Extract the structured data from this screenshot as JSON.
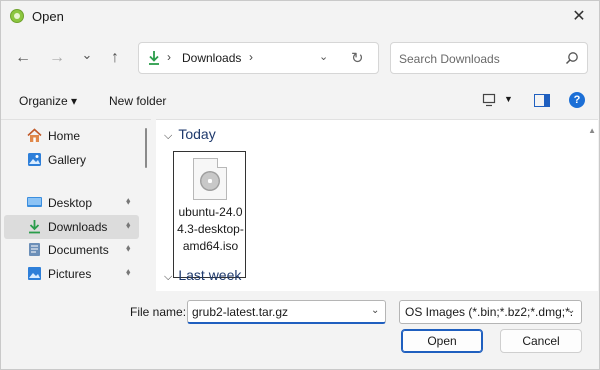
{
  "window": {
    "title": "Open",
    "close_glyph": "✕"
  },
  "nav": {
    "back_glyph": "←",
    "forward_glyph": "→",
    "recent_glyph": "⌄",
    "up_glyph": "↑",
    "address": {
      "icon": "download-arrow-icon",
      "path": "Downloads",
      "sep": "›",
      "drop_glyph": "⌄",
      "refresh_glyph": "↻"
    },
    "search": {
      "placeholder": "Search Downloads"
    }
  },
  "command_bar": {
    "organize_label": "Organize ▾",
    "new_folder_label": "New folder",
    "view_drop_glyph": "▼",
    "help_glyph": "?"
  },
  "sidebar": {
    "items": [
      {
        "label": "Home",
        "icon": "home-icon",
        "pinned": false
      },
      {
        "label": "Gallery",
        "icon": "gallery-icon",
        "pinned": false
      },
      {
        "label": "Desktop",
        "icon": "desktop-icon",
        "pinned": true
      },
      {
        "label": "Downloads",
        "icon": "download-arrow-icon",
        "pinned": true,
        "selected": true
      },
      {
        "label": "Documents",
        "icon": "documents-icon",
        "pinned": true
      },
      {
        "label": "Pictures",
        "icon": "pictures-icon",
        "pinned": true
      }
    ],
    "pin_glyph": "📌"
  },
  "main": {
    "groups": [
      {
        "label": "Today",
        "chevron": "⌵"
      },
      {
        "label": "Last week",
        "chevron": "⌵"
      }
    ],
    "files": [
      {
        "name": "ubuntu-24.04.3-desktop-amd64.iso",
        "icon": "disc-image-file-icon"
      }
    ]
  },
  "footer": {
    "file_name_label": "File name:",
    "file_name_value": "grub2-latest.tar.gz",
    "file_type_value": "OS Images (*.bin;*.bz2;*.dmg;*.",
    "drop_glyph": "⌄",
    "open_label": "Open",
    "cancel_label": "Cancel"
  },
  "colors": {
    "accent": "#1f5fbf",
    "folder_header": "#1f3a6d",
    "download_green": "#2a9d4a"
  }
}
